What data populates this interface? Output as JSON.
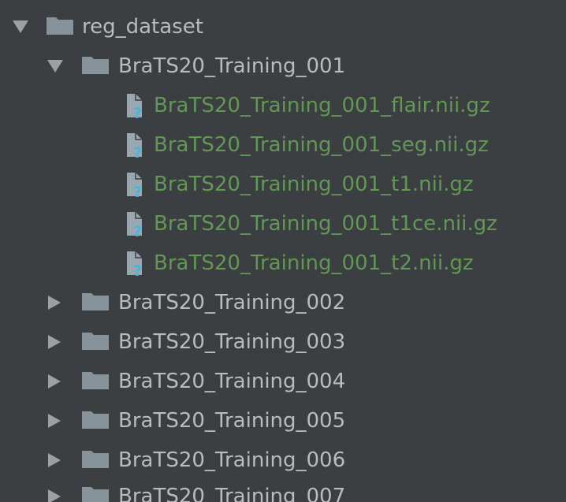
{
  "colors": {
    "background": "#3c3f41",
    "text_default": "#bbbbbb",
    "text_untracked": "#629755",
    "folder_icon": "#87939a",
    "unknown_file_badge": "#40b6e0"
  },
  "tree": {
    "root": {
      "label": "reg_dataset",
      "icon": "folder-icon",
      "expanded": true
    },
    "folder_001": {
      "label": "BraTS20_Training_001",
      "icon": "folder-icon",
      "expanded": true,
      "files": [
        {
          "label": "BraTS20_Training_001_flair.nii.gz",
          "icon": "unknown-file-icon"
        },
        {
          "label": "BraTS20_Training_001_seg.nii.gz",
          "icon": "unknown-file-icon"
        },
        {
          "label": "BraTS20_Training_001_t1.nii.gz",
          "icon": "unknown-file-icon"
        },
        {
          "label": "BraTS20_Training_001_t1ce.nii.gz",
          "icon": "unknown-file-icon"
        },
        {
          "label": "BraTS20_Training_001_t2.nii.gz",
          "icon": "unknown-file-icon"
        }
      ]
    },
    "collapsed_folders": [
      {
        "label": "BraTS20_Training_002",
        "icon": "folder-icon",
        "expanded": false
      },
      {
        "label": "BraTS20_Training_003",
        "icon": "folder-icon",
        "expanded": false
      },
      {
        "label": "BraTS20_Training_004",
        "icon": "folder-icon",
        "expanded": false
      },
      {
        "label": "BraTS20_Training_005",
        "icon": "folder-icon",
        "expanded": false
      },
      {
        "label": "BraTS20_Training_006",
        "icon": "folder-icon",
        "expanded": false
      },
      {
        "label": "BraTS20_Training_007",
        "icon": "folder-icon",
        "expanded": false
      }
    ]
  }
}
